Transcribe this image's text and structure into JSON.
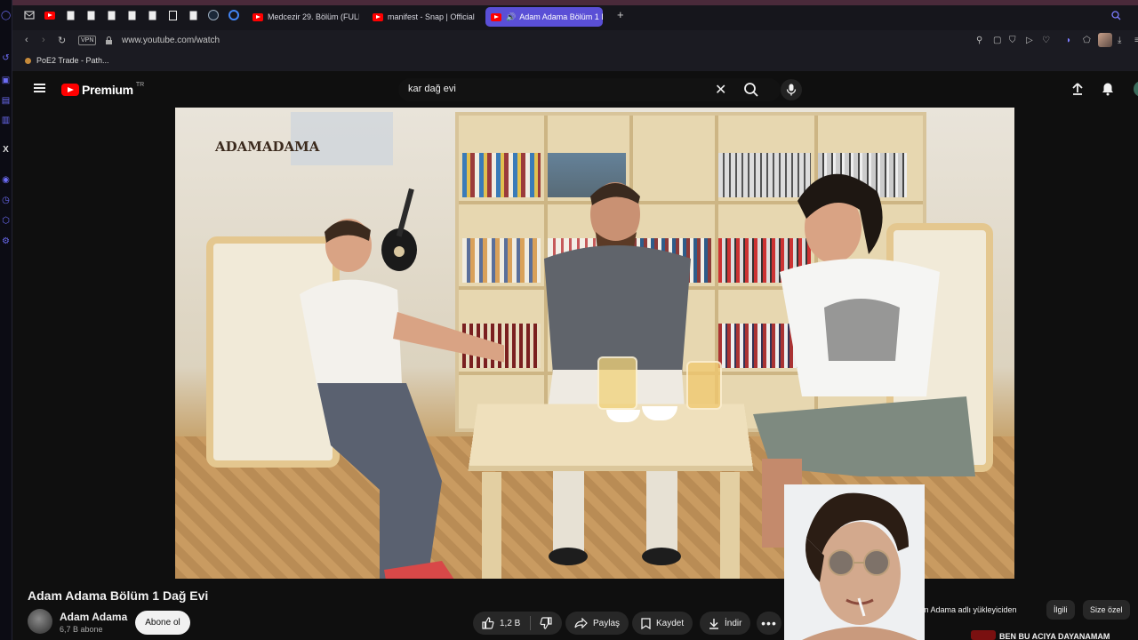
{
  "browser": {
    "tabs": [
      {
        "label": "Medcezir 29. Bölüm (FULL"
      },
      {
        "label": "manifest - Snap | Official"
      },
      {
        "label": "Adam Adama Bölüm 1 Dağ Evi",
        "active": true
      }
    ],
    "vpn_label": "VPN",
    "url": "www.youtube.com/watch",
    "bookmarks": [
      {
        "label": "PoE2 Trade - Path..."
      }
    ]
  },
  "youtube": {
    "logo_text": "Premium",
    "region": "TR",
    "search": {
      "value": "kar dağ evi"
    },
    "video": {
      "overlay_logo": "ADAMADAMA"
    },
    "title": "Adam Adama Bölüm 1 Dağ Evi",
    "channel": {
      "name": "Adam Adama",
      "subscribers": "6,7 B abone"
    },
    "subscribe_label": "Abone ol",
    "actions": {
      "likes": "1,2 B",
      "share": "Paylaş",
      "save": "Kaydet",
      "download": "İndir"
    },
    "chips": [
      "am Adama adlı yükleyiciden",
      "İlgili",
      "Size özel"
    ],
    "recommendation": {
      "title": "BEN BU ACIYA DAYANAMAM"
    }
  },
  "colors": {
    "accent": "#5a4fd6",
    "youtube_red": "#ff0000",
    "background": "#0f0f0f"
  }
}
